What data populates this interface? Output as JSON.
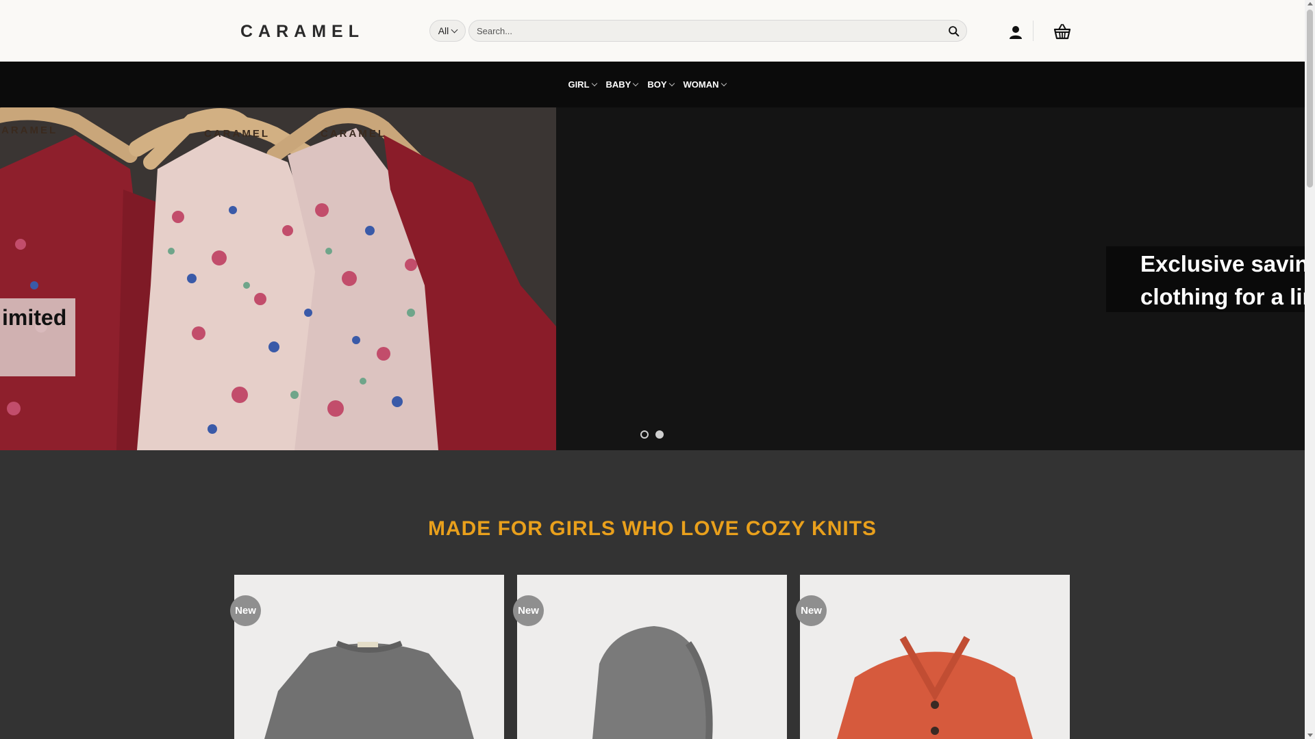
{
  "header": {
    "logo": "CARAMEL",
    "category_select": "All",
    "search_placeholder": "Search..."
  },
  "icons": {
    "search": "search-icon",
    "account": "account-icon",
    "cart": "basket-icon"
  },
  "nav": {
    "items": [
      {
        "label": "GIRL"
      },
      {
        "label": "BABY"
      },
      {
        "label": "BOY"
      },
      {
        "label": "WOMAN"
      }
    ]
  },
  "hero": {
    "caption_left": "imited",
    "caption_right_line1": "Exclusive savings",
    "caption_right_line2": "clothing for a limi",
    "active_slide": 2,
    "slide_count": 2
  },
  "section": {
    "title": "MADE FOR GIRLS WHO LOVE COZY KNITS"
  },
  "products": [
    {
      "badge": "New",
      "item": "grey knit sweater"
    },
    {
      "badge": "New",
      "item": "grey knit bonnet"
    },
    {
      "badge": "New",
      "item": "orange knit cardigan"
    }
  ],
  "colors": {
    "accent": "#e9a01c",
    "nav_bg": "#0b0b0b",
    "section_bg": "#333333",
    "header_bg": "#faf9f6"
  }
}
